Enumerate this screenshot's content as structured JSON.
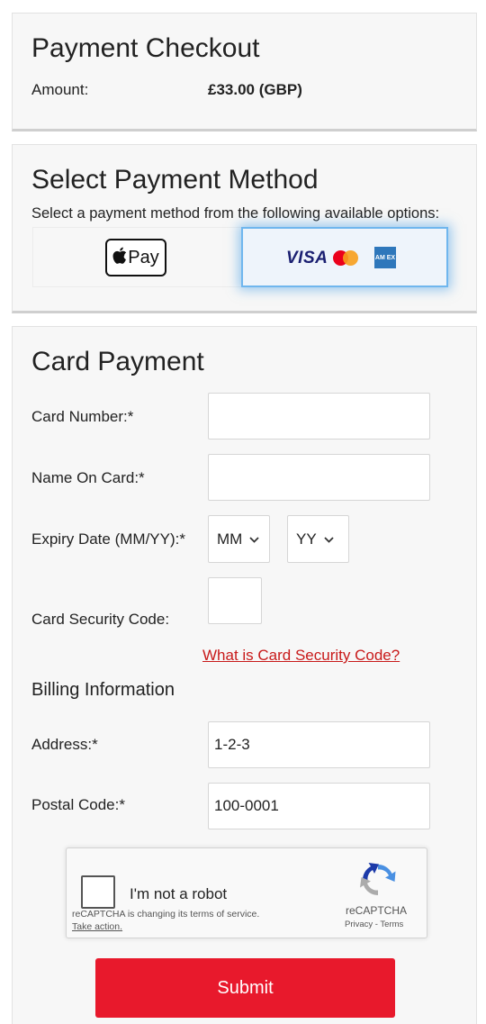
{
  "checkout": {
    "title": "Payment Checkout",
    "amount_label": "Amount:",
    "amount_value": "£33.00 (GBP)"
  },
  "payment_method": {
    "title": "Select Payment Method",
    "description": "Select a payment method from the following available options:",
    "options": [
      {
        "label": "Pay",
        "icon": "apple-icon",
        "selected": false
      },
      {
        "label": "VISA",
        "extra_icons": [
          "mastercard-icon",
          "amex-icon"
        ],
        "selected": true
      }
    ],
    "amex_text": "AM EX"
  },
  "card_payment": {
    "title": "Card Payment",
    "card_number_label": "Card Number:*",
    "card_number_value": "",
    "name_label": "Name On Card:*",
    "name_value": "",
    "expiry_label": "Expiry Date (MM/YY):*",
    "expiry_month": "MM",
    "expiry_year": "YY",
    "csc_label": "Card Security Code:",
    "csc_value": "",
    "csc_link": "What is Card Security Code?",
    "billing_heading": "Billing Information",
    "address_label": "Address:*",
    "address_value": "1-2-3",
    "postal_label": "Postal Code:*",
    "postal_value": "100-0001"
  },
  "recaptcha": {
    "label": "I'm not a robot",
    "notice": "reCAPTCHA is changing its terms of service.",
    "action": "Take action.",
    "brand": "reCAPTCHA",
    "links": "Privacy - Terms"
  },
  "submit_label": "Submit",
  "colors": {
    "submit": "#e8192c",
    "link": "#c81a1a",
    "selected_border": "#6fb6ee",
    "visa": "#1a1f71"
  }
}
